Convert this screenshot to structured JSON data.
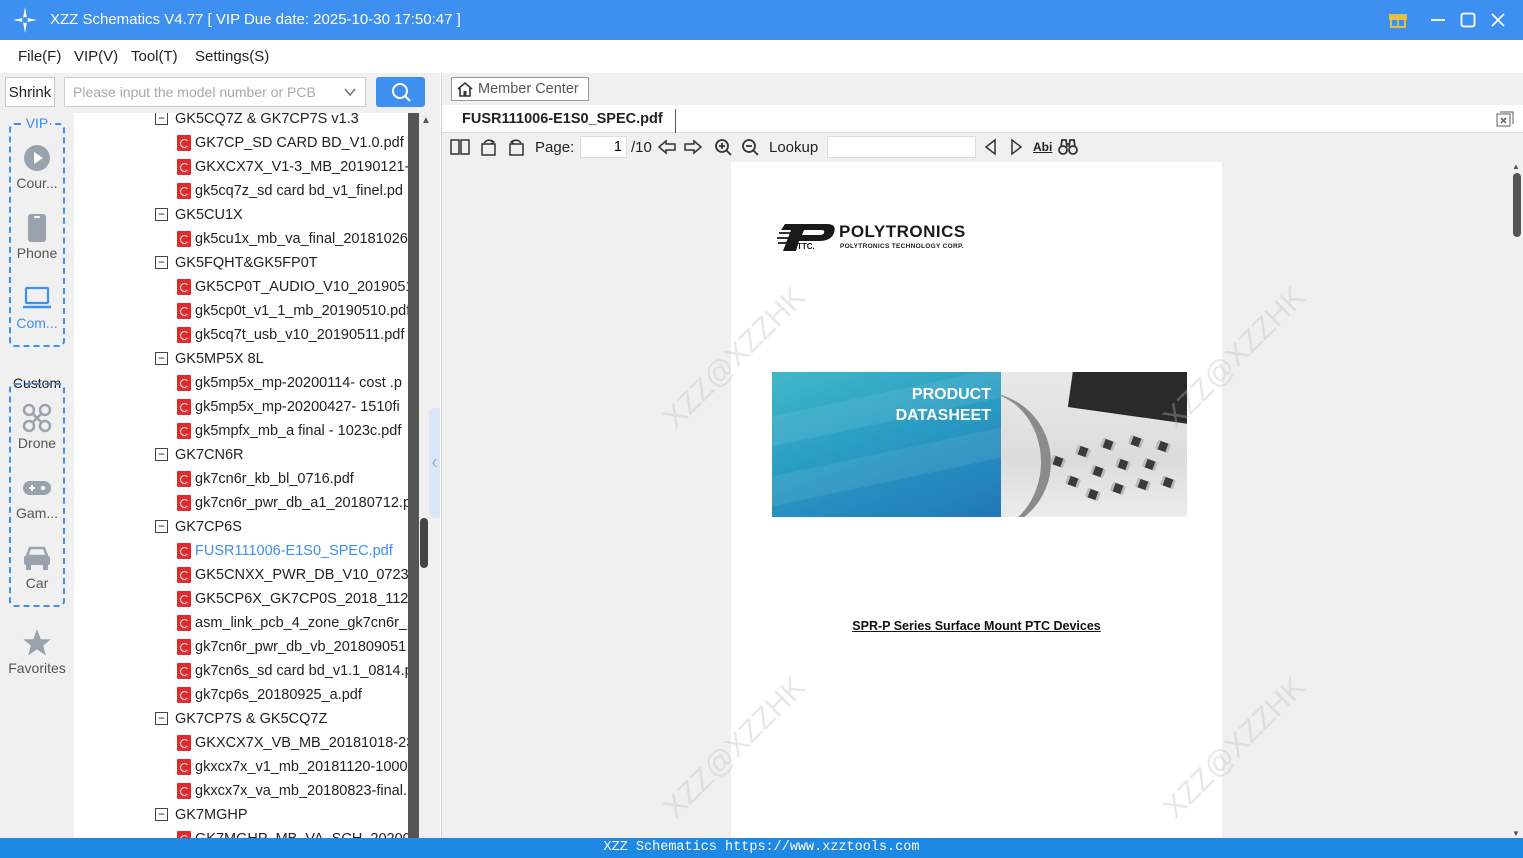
{
  "window": {
    "title": "XZZ Schematics V4.77 [ VIP Due date: 2025-10-30 17:50:47 ]",
    "accent": "#3d8ff0"
  },
  "menu": {
    "file": "File(F)",
    "vip": "VIP(V)",
    "tool": "Tool(T)",
    "settings": "Settings(S)"
  },
  "search": {
    "shrink_label": "Shrink",
    "placeholder": "Please input the model number or PCB"
  },
  "categories": {
    "vip_title": "VIP",
    "vip_items": [
      {
        "label": "Cour...",
        "icon": "play-icon"
      },
      {
        "label": "Phone",
        "icon": "phone-icon"
      },
      {
        "label": "Com...",
        "icon": "laptop-icon"
      }
    ],
    "custom_title": "Custom",
    "custom_items": [
      {
        "label": "Drone",
        "icon": "drone-icon"
      },
      {
        "label": "Gam...",
        "icon": "gamepad-icon"
      },
      {
        "label": "Car",
        "icon": "car-icon"
      }
    ],
    "favorites": "Favorites"
  },
  "tree": [
    {
      "type": "group",
      "label": "GK5CQ7Z & GK7CP7S v1.3"
    },
    {
      "type": "file",
      "label": "GK7CP_SD CARD BD_V1.0.pdf"
    },
    {
      "type": "file",
      "label": "GKXCX7X_V1-3_MB_20190121-F"
    },
    {
      "type": "file",
      "label": "gk5cq7z_sd card bd_v1_finel.pd"
    },
    {
      "type": "group",
      "label": "GK5CU1X"
    },
    {
      "type": "file",
      "label": "gk5cu1x_mb_va_final_20181026"
    },
    {
      "type": "group",
      "label": "GK5FQHT&GK5FP0T"
    },
    {
      "type": "file",
      "label": "GK5CP0T_AUDIO_V10_20190514"
    },
    {
      "type": "file",
      "label": "gk5cp0t_v1_1_mb_20190510.pdf"
    },
    {
      "type": "file",
      "label": "gk5cq7t_usb_v10_20190511.pdf"
    },
    {
      "type": "group",
      "label": "GK5MP5X  8L"
    },
    {
      "type": "file",
      "label": "gk5mp5x_mp-20200114- cost .p"
    },
    {
      "type": "file",
      "label": "gk5mp5x_mp-20200427- 1510fi"
    },
    {
      "type": "file",
      "label": "gk5mpfx_mb_a final - 1023c.pdf"
    },
    {
      "type": "group",
      "label": "GK7CN6R"
    },
    {
      "type": "file",
      "label": "gk7cn6r_kb_bl_0716.pdf"
    },
    {
      "type": "file",
      "label": "gk7cn6r_pwr_db_a1_20180712.p"
    },
    {
      "type": "group",
      "label": "GK7CP6S"
    },
    {
      "type": "file",
      "label": "FUSR111006-E1S0_SPEC.pdf",
      "selected": true
    },
    {
      "type": "file",
      "label": "GK5CNXX_PWR_DB_V10_0723_1"
    },
    {
      "type": "file",
      "label": "GK5CP6X_GK7CP0S_2018_1121.p"
    },
    {
      "type": "file",
      "label": "asm_link_pcb_4_zone_gk7cn6r_2"
    },
    {
      "type": "file",
      "label": "gk7cn6r_pwr_db_vb_201809051"
    },
    {
      "type": "file",
      "label": "gk7cn6s_sd card bd_v1.1_0814.p"
    },
    {
      "type": "file",
      "label": "gk7cp6s_20180925_a.pdf"
    },
    {
      "type": "group",
      "label": "GK7CP7S & GK5CQ7Z"
    },
    {
      "type": "file",
      "label": "GKXCX7X_VB_MB_20181018-230"
    },
    {
      "type": "file",
      "label": "gkxcx7x_v1_mb_20181120-1000"
    },
    {
      "type": "file",
      "label": "gkxcx7x_va_mb_20180823-final."
    },
    {
      "type": "group",
      "label": "GK7MGHP"
    },
    {
      "type": "file",
      "label": "GK7MGHP_MB_VA_SCH_20200"
    }
  ],
  "viewer": {
    "member_center": "Member Center",
    "tab_label": "FUSR111006-E1S0_SPEC.pdf",
    "page_label": "Page:",
    "page_current": "1",
    "page_total": "/10",
    "lookup_label": "Lookup",
    "abi_label": "Abi"
  },
  "document": {
    "brand": "POLYTRONICS",
    "brand_sub": "POLYTRONICS TECHNOLOGY CORP.",
    "brand_mark": "TTC.",
    "banner_line1": "PRODUCT",
    "banner_line2": "DATASHEET",
    "series_title": "SPR-P Series Surface Mount PTC Devices",
    "watermark": "XZZ@XZZHK"
  },
  "status": {
    "text": "XZZ Schematics https://www.xzztools.com"
  }
}
